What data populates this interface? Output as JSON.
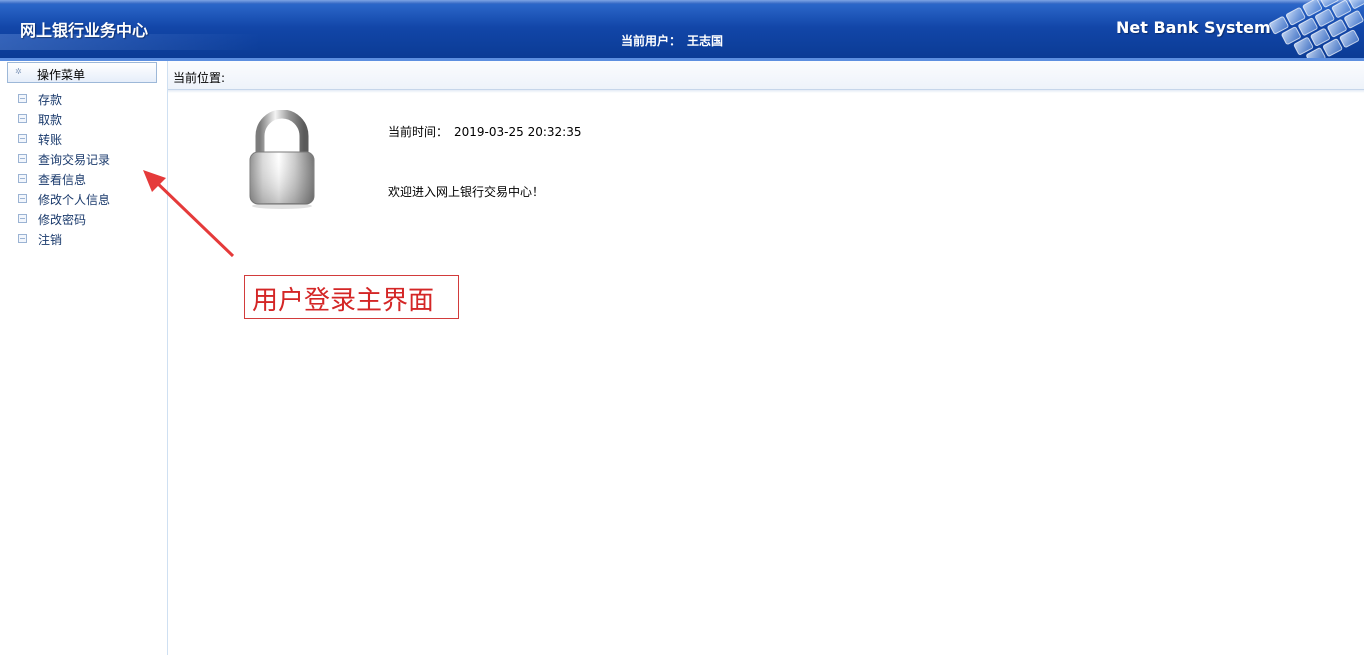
{
  "header": {
    "site_title": "网上银行业务中心",
    "current_user_label": "当前用户：",
    "current_user_name": "王志国",
    "system_name": "Net Bank System"
  },
  "sidebar": {
    "menu_header": "操作菜单",
    "items": [
      {
        "label": "存款",
        "icon": "tree-leaf-icon"
      },
      {
        "label": "取款",
        "icon": "tree-leaf-icon"
      },
      {
        "label": "转账",
        "icon": "tree-leaf-icon"
      },
      {
        "label": "查询交易记录",
        "icon": "tree-leaf-icon"
      },
      {
        "label": "查看信息",
        "icon": "tree-leaf-icon"
      },
      {
        "label": "修改个人信息",
        "icon": "tree-leaf-icon"
      },
      {
        "label": "修改密码",
        "icon": "tree-leaf-icon"
      },
      {
        "label": "注销",
        "icon": "tree-leaf-icon"
      }
    ]
  },
  "main": {
    "location_label": "当前位置:",
    "location_value": "",
    "time_label": "当前时间：",
    "time_value": "2019-03-25 20:32:35",
    "welcome": "欢迎进入网上银行交易中心！",
    "lock_icon": "padlock-icon"
  },
  "annotation": {
    "text": "用户登录主界面",
    "color": "#d42626"
  },
  "colors": {
    "header_blue": "#1246a8",
    "sidebar_text": "#1a3a6c",
    "annotation_red": "#d42626"
  }
}
